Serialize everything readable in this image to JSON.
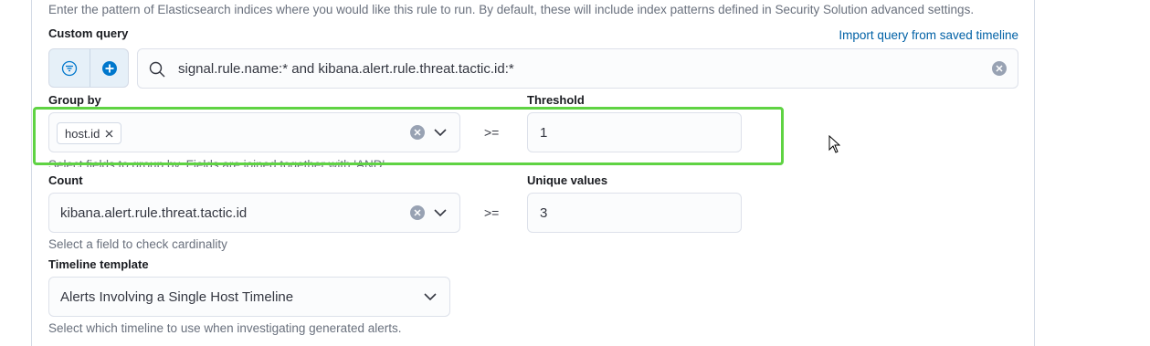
{
  "index_help": "Enter the pattern of Elasticsearch indices where you would like this rule to run. By default, these will include index patterns defined in Security Solution advanced settings.",
  "custom_query": {
    "label": "Custom query",
    "import_link": "Import query from saved timeline",
    "query": "signal.rule.name:* and kibana.alert.rule.threat.tactic.id:*"
  },
  "group_by": {
    "label": "Group by",
    "tag": "host.id",
    "help": "Select fields to group by. Fields are joined together with 'AND'"
  },
  "threshold": {
    "label": "Threshold",
    "operator": ">=",
    "value": "1"
  },
  "count": {
    "label": "Count",
    "value": "kibana.alert.rule.threat.tactic.id",
    "help": "Select a field to check cardinality"
  },
  "unique_values": {
    "label": "Unique values",
    "operator": ">=",
    "value": "3"
  },
  "timeline_template": {
    "label": "Timeline template",
    "value": "Alerts Involving a Single Host Timeline",
    "help": "Select which timeline to use when investigating generated alerts."
  },
  "colors": {
    "highlight": "#5fd343",
    "link": "#0061a6",
    "accent": "#0077cc"
  }
}
